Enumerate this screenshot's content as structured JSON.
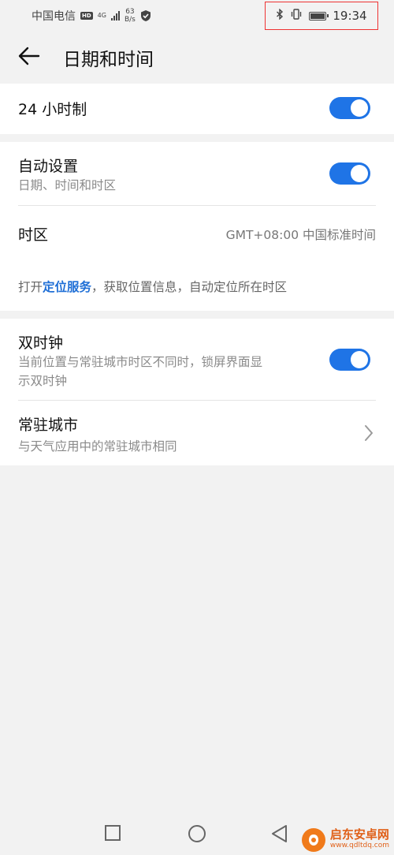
{
  "status_bar": {
    "carrier": "中国电信",
    "hd": "HD",
    "network": "4G",
    "speed_value": "63",
    "speed_unit": "B/s",
    "time": "19:34"
  },
  "header": {
    "title": "日期和时间"
  },
  "rows": {
    "hour24": {
      "title": "24 小时制",
      "enabled": true
    },
    "auto_set": {
      "title": "自动设置",
      "subtitle": "日期、时间和时区",
      "enabled": true
    },
    "timezone": {
      "title": "时区",
      "value": "GMT+08:00 中国标准时间"
    },
    "location_hint": {
      "prefix": "打开",
      "link": "定位服务",
      "suffix": "，获取位置信息，自动定位所在时区"
    },
    "dual_clock": {
      "title": "双时钟",
      "subtitle_line1": "当前位置与常驻城市时区不同时，锁屏界面显",
      "subtitle_line2": "示双时钟",
      "enabled": true
    },
    "home_city": {
      "title": "常驻城市",
      "subtitle": "与天气应用中的常驻城市相同"
    }
  },
  "watermark": {
    "name": "启东安卓网",
    "url": "www.qdltdq.com"
  },
  "colors": {
    "accent": "#1f74e6",
    "highlight_box": "#e33333",
    "background": "#f2f2f2"
  }
}
